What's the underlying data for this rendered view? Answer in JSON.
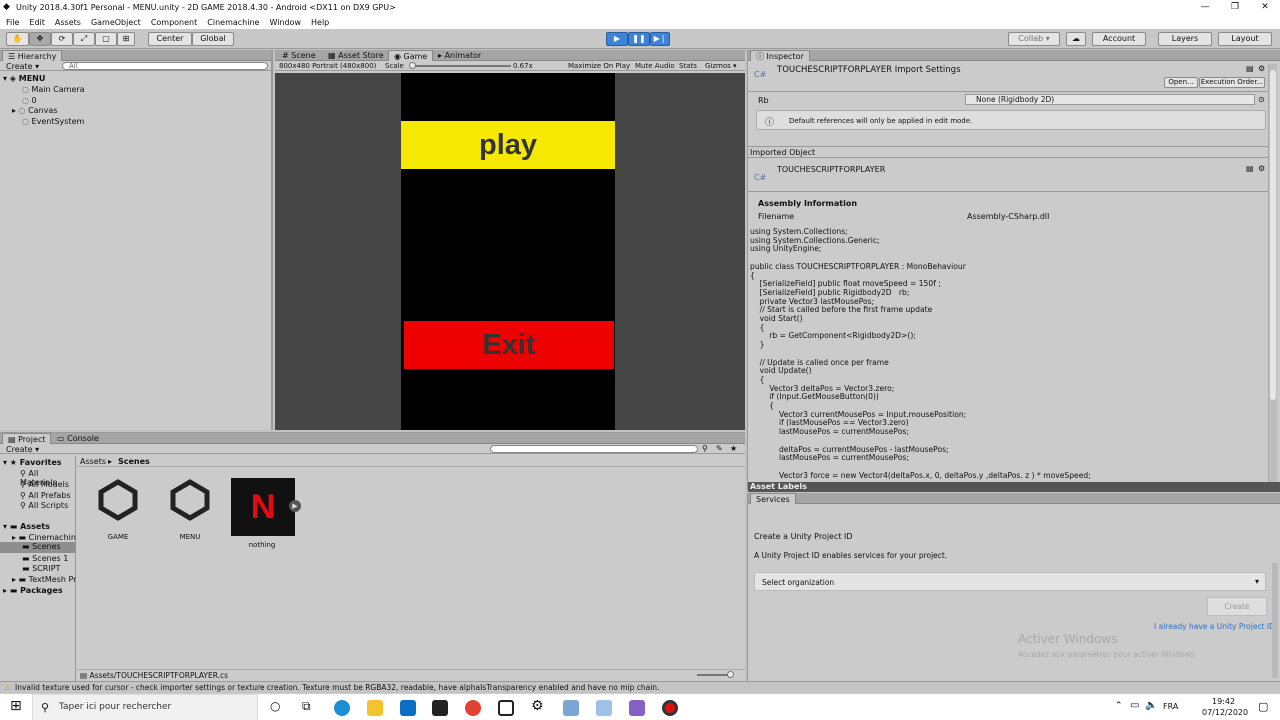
{
  "window": {
    "title": "Unity 2018.4.30f1 Personal - MENU.unity - 2D GAME 2018.4.30 - Android <DX11 on DX9 GPU>",
    "controls": [
      "—",
      "❐",
      "✕"
    ]
  },
  "menubar": [
    "File",
    "Edit",
    "Assets",
    "GameObject",
    "Component",
    "Cinemachine",
    "Window",
    "Help"
  ],
  "toolbar": {
    "pivot": "Center",
    "space": "Global",
    "collab": "Collab ▾",
    "account": "Account",
    "layers": "Layers",
    "layout": "Layout"
  },
  "hierarchy": {
    "tab": "Hierarchy",
    "create": "Create ▾",
    "search_placeholder": "All",
    "scene": "MENU",
    "items": [
      "Main Camera",
      "0",
      "Canvas",
      "EventSystem"
    ]
  },
  "scene_tabs": [
    "Scene",
    "Asset Store",
    "Game",
    "Animator"
  ],
  "game": {
    "resolution": "800x480 Portrait (480x800)",
    "scale_label": "Scale",
    "scale_value": "0.67x",
    "options": [
      "Maximize On Play",
      "Mute Audio",
      "Stats",
      "Gizmos ▾"
    ],
    "play_label": "play",
    "exit_label": "Exit",
    "play_color": "#f6e800",
    "exit_color": "#ee0000"
  },
  "inspector": {
    "tab": "Inspector",
    "title": "TOUCHESCRIPTFORPLAYER Import Settings",
    "open_btn": "Open...",
    "exec_btn": "Execution Order...",
    "field_label": "Rb",
    "field_value": "None (Rigidbody 2D)",
    "info": "Default references will only be applied in edit mode.",
    "imported_header": "Imported Object",
    "imported_name": "TOUCHESCRIPTFORPLAYER",
    "assembly_header": "Assembly Information",
    "filename_label": "Filename",
    "filename_value": "Assembly-CSharp.dll",
    "code": "using System.Collections;\nusing System.Collections.Generic;\nusing UnityEngine;\n\npublic class TOUCHESCRIPTFORPLAYER : MonoBehaviour\n{\n    [SerializeField] public float moveSpeed = 150f ;\n    [SerializeField] public Rigidbody2D   rb;\n    private Vector3 lastMousePos;\n    // Start is called before the first frame update\n    void Start()\n    {\n        rb = GetComponent<Rigidbody2D>();\n    }\n\n    // Update is called once per frame\n    void Update()\n    {\n        Vector3 deltaPos = Vector3.zero;\n        if (Input.GetMouseButton(0))\n        {\n            Vector3 currentMousePos = Input.mousePosition;\n            if (lastMousePos == Vector3.zero)\n            lastMousePos = currentMousePos;\n\n            deltaPos = currentMousePos - lastMousePos;\n            lastMousePos = currentMousePos;\n\n            Vector3 force = new Vector4(deltaPos.x, 0, deltaPos.y ,deltaPos. z ) * moveSpeed;",
    "asset_labels": "Asset Labels"
  },
  "services": {
    "tab": "Services",
    "heading": "Create a Unity Project ID",
    "desc": "A Unity Project ID enables services for your project.",
    "select": "Select organization",
    "create_btn": "Create",
    "link": "I already have a Unity Project ID",
    "watermark1": "Activer Windows",
    "watermark2": "Accédez aux paramètres pour activer Windows"
  },
  "project": {
    "tabs": [
      "Project",
      "Console"
    ],
    "create": "Create ▾",
    "breadcrumb": [
      "Assets",
      "Scenes"
    ],
    "favorites_label": "Favorites",
    "favorites": [
      "All Materials",
      "All Models",
      "All Prefabs",
      "All Scripts"
    ],
    "assets_label": "Assets",
    "asset_folders": [
      "Cinemachine",
      "Scenes",
      "Scenes 1",
      "SCRIPT",
      "TextMesh Pro"
    ],
    "packages_label": "Packages",
    "files": [
      "GAME",
      "MENU",
      "nothing"
    ],
    "path": "Assets/TOUCHESCRIPTFORPLAYER.cs"
  },
  "statusbar": "Invalid texture used for cursor - check importer settings or texture creation. Texture must be RGBA32, readable, have alphaIsTransparency enabled and have no mip chain.",
  "taskbar": {
    "search": "Taper ici pour rechercher",
    "lang": "FRA",
    "time": "19:42",
    "date": "07/12/2020"
  }
}
